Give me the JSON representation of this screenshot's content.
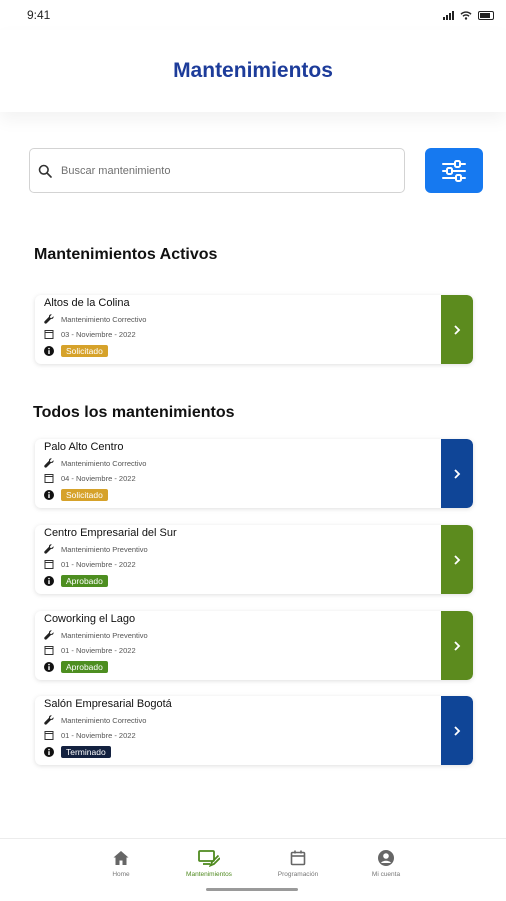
{
  "status_bar": {
    "time": "9:41"
  },
  "header": {
    "title": "Mantenimientos"
  },
  "search": {
    "placeholder": "Buscar mantenimiento"
  },
  "colors": {
    "title_blue": "#1d3c9a",
    "filter_button": "#1679f0",
    "green": "#5c8b1e",
    "navy": "#0f4597",
    "badge_solicitado": "#d6a22a",
    "badge_aprobado": "#4d8e20",
    "badge_terminado": "#13213f"
  },
  "sections": {
    "active_title": "Mantenimientos Activos",
    "all_title": "Todos los mantenimientos"
  },
  "active_items": [
    {
      "name": "Altos de la Colina",
      "type": "Mantenimiento Correctivo",
      "date": "03 - Noviembre - 2022",
      "status": "Solicitado"
    }
  ],
  "all_items": [
    {
      "name": "Palo Alto Centro",
      "type": "Mantenimiento Correctivo",
      "date": "04 - Noviembre - 2022",
      "status": "Solicitado"
    },
    {
      "name": "Centro Empresarial del Sur",
      "type": "Mantenimiento Preventivo",
      "date": "01 - Noviembre - 2022",
      "status": "Aprobado"
    },
    {
      "name": "Coworking el Lago",
      "type": "Mantenimiento Preventivo",
      "date": "01 - Noviembre - 2022",
      "status": "Aprobado"
    },
    {
      "name": "Salón Empresarial Bogotá",
      "type": "Mantenimiento Correctivo",
      "date": "01 - Noviembre - 2022",
      "status": "Terminado"
    }
  ],
  "bottom_nav": {
    "items": [
      {
        "label": "Home",
        "icon": "home-icon"
      },
      {
        "label": "Mantenimientos",
        "icon": "maintenance-icon"
      },
      {
        "label": "Programación",
        "icon": "calendar-icon"
      },
      {
        "label": "Mi cuenta",
        "icon": "account-icon"
      }
    ],
    "active": "Mantenimientos"
  }
}
